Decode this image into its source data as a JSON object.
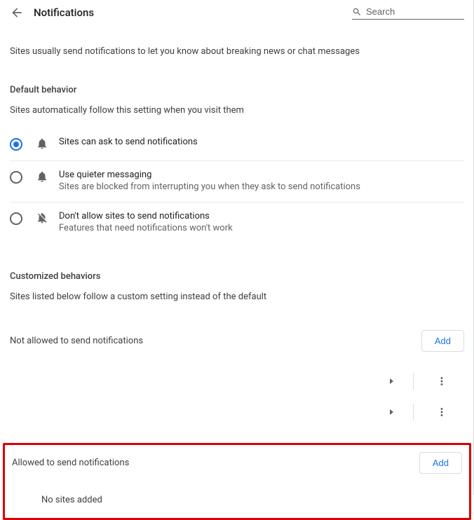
{
  "header": {
    "title": "Notifications",
    "search_placeholder": "Search"
  },
  "intro": "Sites usually send notifications to let you know about breaking news or chat messages",
  "default_behavior": {
    "heading": "Default behavior",
    "sub": "Sites automatically follow this setting when you visit them",
    "options": [
      {
        "title": "Sites can ask to send notifications",
        "desc": "",
        "selected": true
      },
      {
        "title": "Use quieter messaging",
        "desc": "Sites are blocked from interrupting you when they ask to send notifications",
        "selected": false
      },
      {
        "title": "Don't allow sites to send notifications",
        "desc": "Features that need notifications won't work",
        "selected": false
      }
    ]
  },
  "customized": {
    "heading": "Customized behaviors",
    "sub": "Sites listed below follow a custom setting instead of the default"
  },
  "not_allowed": {
    "label": "Not allowed to send notifications",
    "add_label": "Add"
  },
  "allowed": {
    "label": "Allowed to send notifications",
    "add_label": "Add",
    "empty": "No sites added"
  }
}
